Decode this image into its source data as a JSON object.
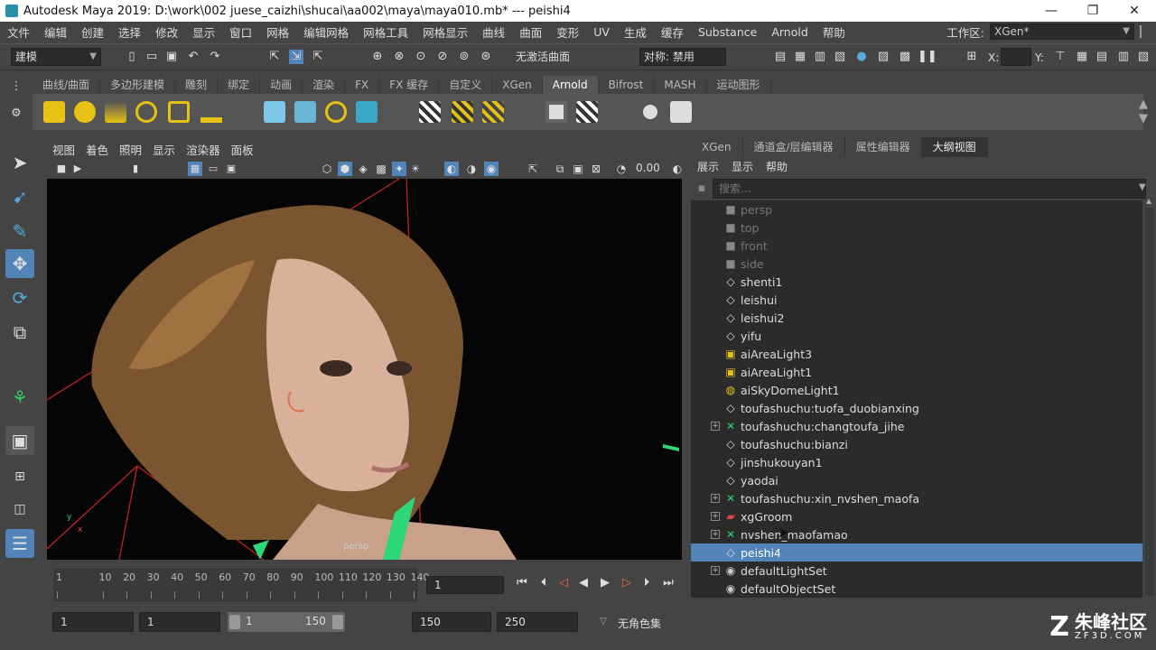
{
  "window": {
    "title": "Autodesk Maya 2019: D:\\work\\002 juese_caizhi\\shucai\\aa002\\maya\\maya010.mb*   ---   peishi4",
    "minimize": "—",
    "maximize": "❐",
    "close": "✕"
  },
  "menus": [
    "文件",
    "编辑",
    "创建",
    "选择",
    "修改",
    "显示",
    "窗口",
    "网格",
    "编辑网格",
    "网格工具",
    "网格显示",
    "曲线",
    "曲面",
    "变形",
    "UV",
    "生成",
    "缓存",
    "Substance",
    "Arnold",
    "帮助"
  ],
  "workspace": {
    "label": "工作区:",
    "value": "XGen*"
  },
  "toolbar": {
    "mode": "建模",
    "live_surface": "无激活曲面",
    "symmetry": "对称: 禁用",
    "x_label": "X:",
    "y_label": "Y:"
  },
  "shelf_tabs": [
    "曲线/曲面",
    "多边形建模",
    "雕刻",
    "绑定",
    "动画",
    "渲染",
    "FX",
    "FX 缓存",
    "自定义",
    "XGen",
    "Arnold",
    "Bifrost",
    "MASH",
    "运动图形"
  ],
  "shelf_active": "Arnold",
  "viewport_menu": [
    "视图",
    "着色",
    "照明",
    "显示",
    "渲染器",
    "面板"
  ],
  "viewport": {
    "camera_label": "persp",
    "exposure": "0.00"
  },
  "timeline": {
    "ticks": [
      "1",
      "10",
      "20",
      "30",
      "40",
      "50",
      "60",
      "70",
      "80",
      "90",
      "100",
      "110",
      "120",
      "130",
      "140"
    ],
    "current_frame": "1"
  },
  "range": {
    "start": "1",
    "playback_start": "1",
    "slider_start": "1",
    "slider_end": "150",
    "playback_end": "150",
    "end": "250",
    "character_set": "无角色集"
  },
  "right_tabs": [
    "XGen",
    "通道盒/层编辑器",
    "属性编辑器",
    "大纲视图"
  ],
  "right_active": "大纲视图",
  "outliner_menu": [
    "展示",
    "显示",
    "帮助"
  ],
  "search_placeholder": "搜索...",
  "outliner": [
    {
      "label": "persp",
      "icon": "camera-icon",
      "dim": true,
      "expand": false
    },
    {
      "label": "top",
      "icon": "camera-icon",
      "dim": true,
      "expand": false
    },
    {
      "label": "front",
      "icon": "camera-icon",
      "dim": true,
      "expand": false
    },
    {
      "label": "side",
      "icon": "camera-icon",
      "dim": true,
      "expand": false
    },
    {
      "label": "shenti1",
      "icon": "transform-icon",
      "dim": false,
      "expand": false
    },
    {
      "label": "leishui",
      "icon": "transform-icon",
      "dim": false,
      "expand": false
    },
    {
      "label": "leishui2",
      "icon": "transform-icon",
      "dim": false,
      "expand": false
    },
    {
      "label": "yifu",
      "icon": "transform-icon",
      "dim": false,
      "expand": false
    },
    {
      "label": "aiAreaLight3",
      "icon": "area-light-icon",
      "dim": false,
      "expand": false
    },
    {
      "label": "aiAreaLight1",
      "icon": "area-light-icon",
      "dim": false,
      "expand": false
    },
    {
      "label": "aiSkyDomeLight1",
      "icon": "skydome-icon",
      "dim": false,
      "expand": false
    },
    {
      "label": "toufashuchu:tuofa_duobianxing",
      "icon": "transform-icon",
      "dim": false,
      "expand": false
    },
    {
      "label": "toufashuchu:changtoufa_jihe",
      "icon": "xgen-icon",
      "dim": false,
      "expand": true
    },
    {
      "label": "toufashuchu:bianzi",
      "icon": "transform-icon",
      "dim": false,
      "expand": false
    },
    {
      "label": "jinshukouyan1",
      "icon": "transform-icon",
      "dim": false,
      "expand": false
    },
    {
      "label": "yaodai",
      "icon": "transform-icon",
      "dim": false,
      "expand": false
    },
    {
      "label": "toufashuchu:xin_nvshen_maofa",
      "icon": "xgen-icon",
      "dim": false,
      "expand": true
    },
    {
      "label": "xgGroom",
      "icon": "groom-icon",
      "dim": false,
      "expand": true
    },
    {
      "label": "nvshen_maofamao",
      "icon": "xgen-icon",
      "dim": false,
      "expand": true
    },
    {
      "label": "peishi4",
      "icon": "transform-icon",
      "dim": false,
      "expand": false,
      "selected": true
    },
    {
      "label": "defaultLightSet",
      "icon": "set-icon",
      "dim": false,
      "expand": true
    },
    {
      "label": "defaultObjectSet",
      "icon": "set-icon",
      "dim": false,
      "expand": false
    }
  ],
  "watermark": {
    "brand": "朱峰社区",
    "site": "ZF3D.COM"
  }
}
